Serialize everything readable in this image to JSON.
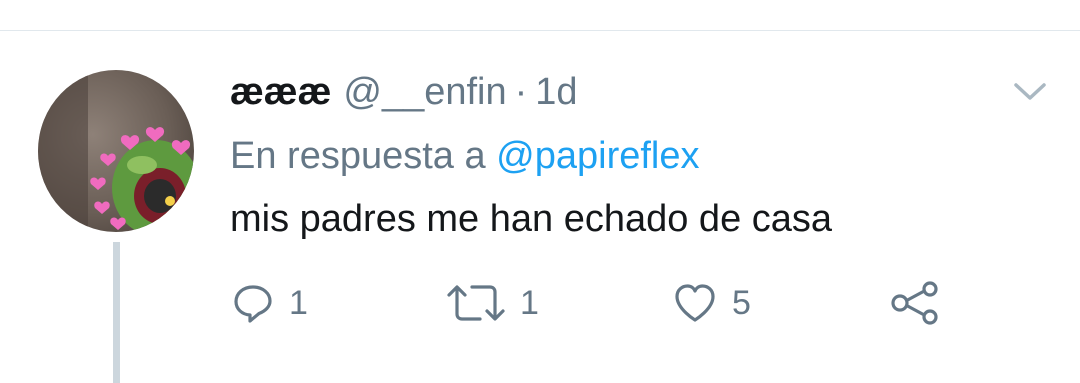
{
  "tweet": {
    "display_name": "æææ",
    "handle": "@__enfin",
    "separator": "·",
    "time": "1d",
    "reply_prefix": "En respuesta a",
    "reply_to": "@papireflex",
    "text": "mis padres me han echado de casa"
  },
  "actions": {
    "reply_count": "1",
    "retweet_count": "1",
    "like_count": "5"
  },
  "icons": {
    "menu": "chevron-down-icon",
    "reply": "reply-icon",
    "retweet": "retweet-icon",
    "like": "heart-icon",
    "share": "share-icon"
  },
  "colors": {
    "text": "#14171a",
    "secondary": "#657786",
    "link": "#1da1f2",
    "divider": "#e1e8ed",
    "thread_line": "#ccd6dd"
  }
}
